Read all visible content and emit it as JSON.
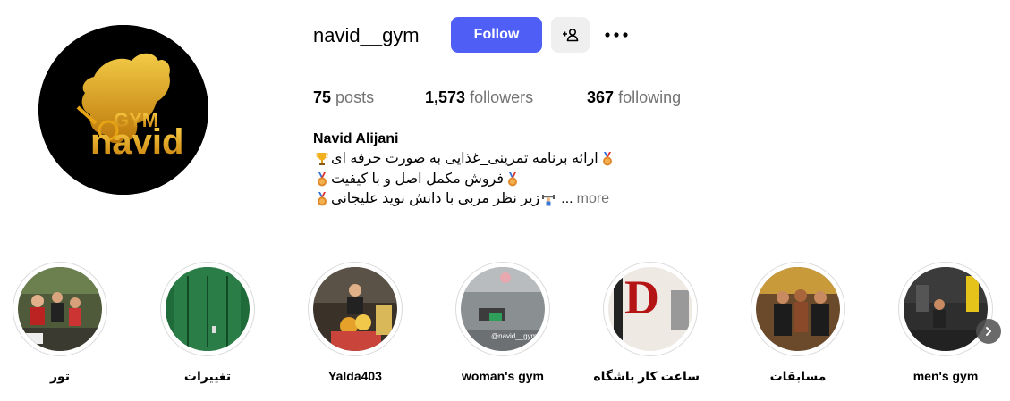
{
  "profile": {
    "username": "navid__gym",
    "follow_label": "Follow",
    "avatar_icon": "gym-navid-logo",
    "logo_text_top": "GYM",
    "logo_text_bottom": "navid",
    "suggest_icon": "add-person-icon",
    "more_icon": "ellipsis-icon"
  },
  "stats": {
    "posts_count": "75",
    "posts_label": "posts",
    "followers_count": "1,573",
    "followers_label": "followers",
    "following_count": "367",
    "following_label": "following"
  },
  "bio": {
    "name": "Navid Alijani",
    "line1": "ارائه برنامه تمرینی_غذایی به صورت حرفه ای",
    "line2": "فروش مکمل اصل و با کیفیت",
    "line3": "زیر نظر مربی با دانش نوید علیجانی",
    "ellipsis": "...",
    "more_label": "more",
    "emoji": {
      "medal": "medal-icon",
      "trophy": "trophy-icon",
      "weightlifter": "weightlifter-icon"
    }
  },
  "highlights": [
    {
      "label": "تور"
    },
    {
      "label": "تغییرات"
    },
    {
      "label": "Yalda403"
    },
    {
      "label": "woman's gym",
      "sticker_text": "@navid__gym"
    },
    {
      "label": "ساعت کار باشگاه"
    },
    {
      "label": "مسابقات"
    },
    {
      "label": "men's gym"
    }
  ],
  "colors": {
    "follow_button": "#4f5ef5",
    "secondary_text": "#737373",
    "logo_gold": "#e6a313"
  }
}
